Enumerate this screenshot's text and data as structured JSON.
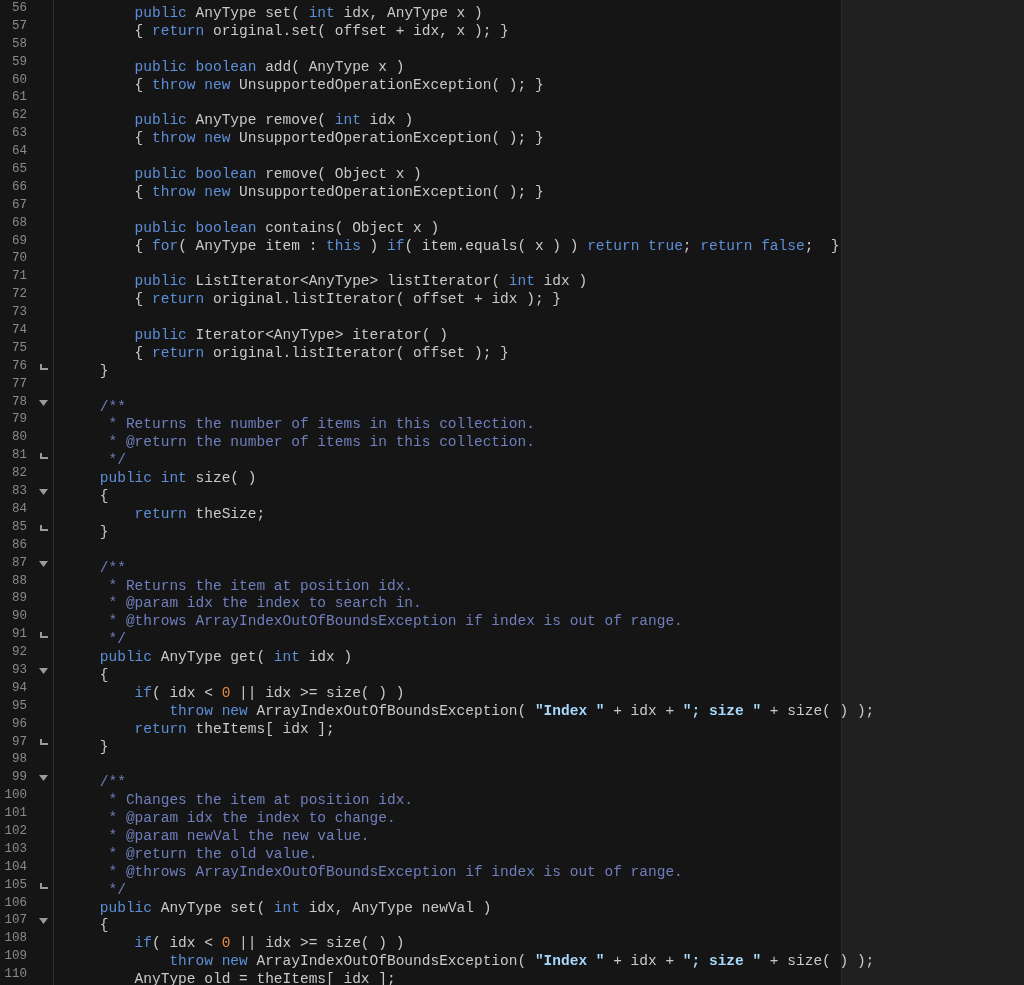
{
  "lines": [
    {
      "number": "56",
      "kind": "code",
      "tokens": [
        {
          "kind": "kw",
          "text": "        public"
        },
        {
          "kind": "pl",
          "text": " AnyType set( "
        },
        {
          "kind": "kw",
          "text": "int"
        },
        {
          "kind": "pl",
          "text": " idx, AnyType x )"
        }
      ]
    },
    {
      "number": "57",
      "kind": "code",
      "tokens": [
        {
          "kind": "pl",
          "text": "        { "
        },
        {
          "kind": "kw",
          "text": "return"
        },
        {
          "kind": "pl",
          "text": " original.set( offset + idx, x ); }"
        }
      ]
    },
    {
      "number": "58",
      "kind": "code"
    },
    {
      "number": "59",
      "kind": "code",
      "tokens": [
        {
          "kind": "kw",
          "text": "        public boolean"
        },
        {
          "kind": "pl",
          "text": " add( AnyType x )"
        }
      ]
    },
    {
      "number": "60",
      "kind": "code",
      "tokens": [
        {
          "kind": "pl",
          "text": "        { "
        },
        {
          "kind": "kw",
          "text": "throw new"
        },
        {
          "kind": "pl",
          "text": " UnsupportedOperationException( ); }"
        }
      ]
    },
    {
      "number": "61",
      "kind": "code"
    },
    {
      "number": "62",
      "kind": "code",
      "tokens": [
        {
          "kind": "kw",
          "text": "        public"
        },
        {
          "kind": "pl",
          "text": " AnyType remove( "
        },
        {
          "kind": "kw",
          "text": "int"
        },
        {
          "kind": "pl",
          "text": " idx )"
        }
      ]
    },
    {
      "number": "63",
      "kind": "code",
      "tokens": [
        {
          "kind": "pl",
          "text": "        { "
        },
        {
          "kind": "kw",
          "text": "throw new"
        },
        {
          "kind": "pl",
          "text": " UnsupportedOperationException( ); }"
        }
      ]
    },
    {
      "number": "64",
      "kind": "code"
    },
    {
      "number": "65",
      "kind": "code",
      "tokens": [
        {
          "kind": "kw",
          "text": "        public boolean"
        },
        {
          "kind": "pl",
          "text": " remove( Object x )"
        }
      ]
    },
    {
      "number": "66",
      "kind": "code",
      "tokens": [
        {
          "kind": "pl",
          "text": "        { "
        },
        {
          "kind": "kw",
          "text": "throw new"
        },
        {
          "kind": "pl",
          "text": " UnsupportedOperationException( ); }"
        }
      ]
    },
    {
      "number": "67",
      "kind": "code"
    },
    {
      "number": "68",
      "kind": "code",
      "tokens": [
        {
          "kind": "kw",
          "text": "        public boolean"
        },
        {
          "kind": "pl",
          "text": " contains( Object x )"
        }
      ]
    },
    {
      "number": "69",
      "kind": "code",
      "tokens": [
        {
          "kind": "pl",
          "text": "        { "
        },
        {
          "kind": "kw",
          "text": "for"
        },
        {
          "kind": "pl",
          "text": "( AnyType item : "
        },
        {
          "kind": "kw",
          "text": "this"
        },
        {
          "kind": "pl",
          "text": " ) "
        },
        {
          "kind": "kw",
          "text": "if"
        },
        {
          "kind": "pl",
          "text": "( item.equals( x ) ) "
        },
        {
          "kind": "kw",
          "text": "return true"
        },
        {
          "kind": "pl",
          "text": "; "
        },
        {
          "kind": "kw",
          "text": "return false"
        },
        {
          "kind": "pl",
          "text": ";  }"
        }
      ]
    },
    {
      "number": "70",
      "kind": "code"
    },
    {
      "number": "71",
      "kind": "code",
      "tokens": [
        {
          "kind": "kw",
          "text": "        public"
        },
        {
          "kind": "pl",
          "text": " ListIterator<AnyType> listIterator( "
        },
        {
          "kind": "kw",
          "text": "int"
        },
        {
          "kind": "pl",
          "text": " idx )"
        }
      ]
    },
    {
      "number": "72",
      "kind": "code",
      "tokens": [
        {
          "kind": "pl",
          "text": "        { "
        },
        {
          "kind": "kw",
          "text": "return"
        },
        {
          "kind": "pl",
          "text": " original.listIterator( offset + idx ); }"
        }
      ]
    },
    {
      "number": "73",
      "kind": "code"
    },
    {
      "number": "74",
      "kind": "code",
      "tokens": [
        {
          "kind": "kw",
          "text": "        public"
        },
        {
          "kind": "pl",
          "text": " Iterator<AnyType> iterator( )"
        }
      ]
    },
    {
      "number": "75",
      "kind": "code",
      "tokens": [
        {
          "kind": "pl",
          "text": "        { "
        },
        {
          "kind": "kw",
          "text": "return"
        },
        {
          "kind": "pl",
          "text": " original.listIterator( offset ); }"
        }
      ]
    },
    {
      "number": "76",
      "kind": "fold_end",
      "tokens": [
        {
          "kind": "pl",
          "text": "    }"
        }
      ]
    },
    {
      "number": "77",
      "kind": "code"
    },
    {
      "number": "78",
      "kind": "fold_start",
      "tokens": [
        {
          "kind": "cm",
          "text": "    /**"
        }
      ]
    },
    {
      "number": "79",
      "kind": "code",
      "tokens": [
        {
          "kind": "cm",
          "text": "     * Returns the number of items in this collection."
        }
      ]
    },
    {
      "number": "80",
      "kind": "code",
      "tokens": [
        {
          "kind": "cm",
          "text": "     * @return the number of items in this collection."
        }
      ]
    },
    {
      "number": "81",
      "kind": "fold_end",
      "tokens": [
        {
          "kind": "cm",
          "text": "     */"
        }
      ]
    },
    {
      "number": "82",
      "kind": "code",
      "tokens": [
        {
          "kind": "kw",
          "text": "    public int"
        },
        {
          "kind": "pl",
          "text": " size( )"
        }
      ]
    },
    {
      "number": "83",
      "kind": "fold_start",
      "tokens": [
        {
          "kind": "pl",
          "text": "    {"
        }
      ]
    },
    {
      "number": "84",
      "kind": "code",
      "tokens": [
        {
          "kind": "kw",
          "text": "        return"
        },
        {
          "kind": "pl",
          "text": " theSize;"
        }
      ]
    },
    {
      "number": "85",
      "kind": "fold_end",
      "tokens": [
        {
          "kind": "pl",
          "text": "    }"
        }
      ]
    },
    {
      "number": "86",
      "kind": "code"
    },
    {
      "number": "87",
      "kind": "fold_start",
      "tokens": [
        {
          "kind": "cm",
          "text": "    /**"
        }
      ]
    },
    {
      "number": "88",
      "kind": "code",
      "tokens": [
        {
          "kind": "cm",
          "text": "     * Returns the item at position idx."
        }
      ]
    },
    {
      "number": "89",
      "kind": "code",
      "tokens": [
        {
          "kind": "cm",
          "text": "     * @param idx the index to search in."
        }
      ]
    },
    {
      "number": "90",
      "kind": "code",
      "tokens": [
        {
          "kind": "cm",
          "text": "     * @throws ArrayIndexOutOfBoundsException if index is out of range."
        }
      ]
    },
    {
      "number": "91",
      "kind": "fold_end",
      "tokens": [
        {
          "kind": "cm",
          "text": "     */"
        }
      ]
    },
    {
      "number": "92",
      "kind": "code",
      "tokens": [
        {
          "kind": "kw",
          "text": "    public"
        },
        {
          "kind": "pl",
          "text": " AnyType get( "
        },
        {
          "kind": "kw",
          "text": "int"
        },
        {
          "kind": "pl",
          "text": " idx )"
        }
      ]
    },
    {
      "number": "93",
      "kind": "fold_start",
      "tokens": [
        {
          "kind": "pl",
          "text": "    {"
        }
      ]
    },
    {
      "number": "94",
      "kind": "code",
      "tokens": [
        {
          "kind": "kw",
          "text": "        if"
        },
        {
          "kind": "pl",
          "text": "( idx < "
        },
        {
          "kind": "num",
          "text": "0"
        },
        {
          "kind": "pl",
          "text": " || idx >= size( ) )"
        }
      ]
    },
    {
      "number": "95",
      "kind": "code",
      "tokens": [
        {
          "kind": "kw",
          "text": "            throw new"
        },
        {
          "kind": "pl",
          "text": " ArrayIndexOutOfBoundsException( "
        },
        {
          "kind": "str",
          "text": "\"Index \""
        },
        {
          "kind": "pl",
          "text": " + idx + "
        },
        {
          "kind": "str",
          "text": "\"; size \""
        },
        {
          "kind": "pl",
          "text": " + size( ) );"
        }
      ]
    },
    {
      "number": "96",
      "kind": "code",
      "tokens": [
        {
          "kind": "kw",
          "text": "        return"
        },
        {
          "kind": "pl",
          "text": " theItems[ idx ];"
        }
      ]
    },
    {
      "number": "97",
      "kind": "fold_end",
      "tokens": [
        {
          "kind": "pl",
          "text": "    }"
        }
      ]
    },
    {
      "number": "98",
      "kind": "code"
    },
    {
      "number": "99",
      "kind": "fold_start",
      "tokens": [
        {
          "kind": "cm",
          "text": "    /**"
        }
      ]
    },
    {
      "number": "100",
      "kind": "code",
      "tokens": [
        {
          "kind": "cm",
          "text": "     * Changes the item at position idx."
        }
      ]
    },
    {
      "number": "101",
      "kind": "code",
      "tokens": [
        {
          "kind": "cm",
          "text": "     * @param idx the index to change."
        }
      ]
    },
    {
      "number": "102",
      "kind": "code",
      "tokens": [
        {
          "kind": "cm",
          "text": "     * @param newVal the new value."
        }
      ]
    },
    {
      "number": "103",
      "kind": "code",
      "tokens": [
        {
          "kind": "cm",
          "text": "     * @return the old value."
        }
      ]
    },
    {
      "number": "104",
      "kind": "code",
      "tokens": [
        {
          "kind": "cm",
          "text": "     * @throws ArrayIndexOutOfBoundsException if index is out of range."
        }
      ]
    },
    {
      "number": "105",
      "kind": "fold_end",
      "tokens": [
        {
          "kind": "cm",
          "text": "     */"
        }
      ]
    },
    {
      "number": "106",
      "kind": "code",
      "tokens": [
        {
          "kind": "kw",
          "text": "    public"
        },
        {
          "kind": "pl",
          "text": " AnyType set( "
        },
        {
          "kind": "kw",
          "text": "int"
        },
        {
          "kind": "pl",
          "text": " idx, AnyType newVal )"
        }
      ]
    },
    {
      "number": "107",
      "kind": "fold_start",
      "tokens": [
        {
          "kind": "pl",
          "text": "    {"
        }
      ]
    },
    {
      "number": "108",
      "kind": "code",
      "tokens": [
        {
          "kind": "kw",
          "text": "        if"
        },
        {
          "kind": "pl",
          "text": "( idx < "
        },
        {
          "kind": "num",
          "text": "0"
        },
        {
          "kind": "pl",
          "text": " || idx >= size( ) )"
        }
      ]
    },
    {
      "number": "109",
      "kind": "code",
      "tokens": [
        {
          "kind": "kw",
          "text": "            throw new"
        },
        {
          "kind": "pl",
          "text": " ArrayIndexOutOfBoundsException( "
        },
        {
          "kind": "str",
          "text": "\"Index \""
        },
        {
          "kind": "pl",
          "text": " + idx + "
        },
        {
          "kind": "str",
          "text": "\"; size \""
        },
        {
          "kind": "pl",
          "text": " + size( ) );"
        }
      ]
    },
    {
      "number": "110",
      "kind": "code",
      "tokens": [
        {
          "kind": "pl",
          "text": "        AnyType old = theItems[ idx ];"
        }
      ]
    }
  ]
}
